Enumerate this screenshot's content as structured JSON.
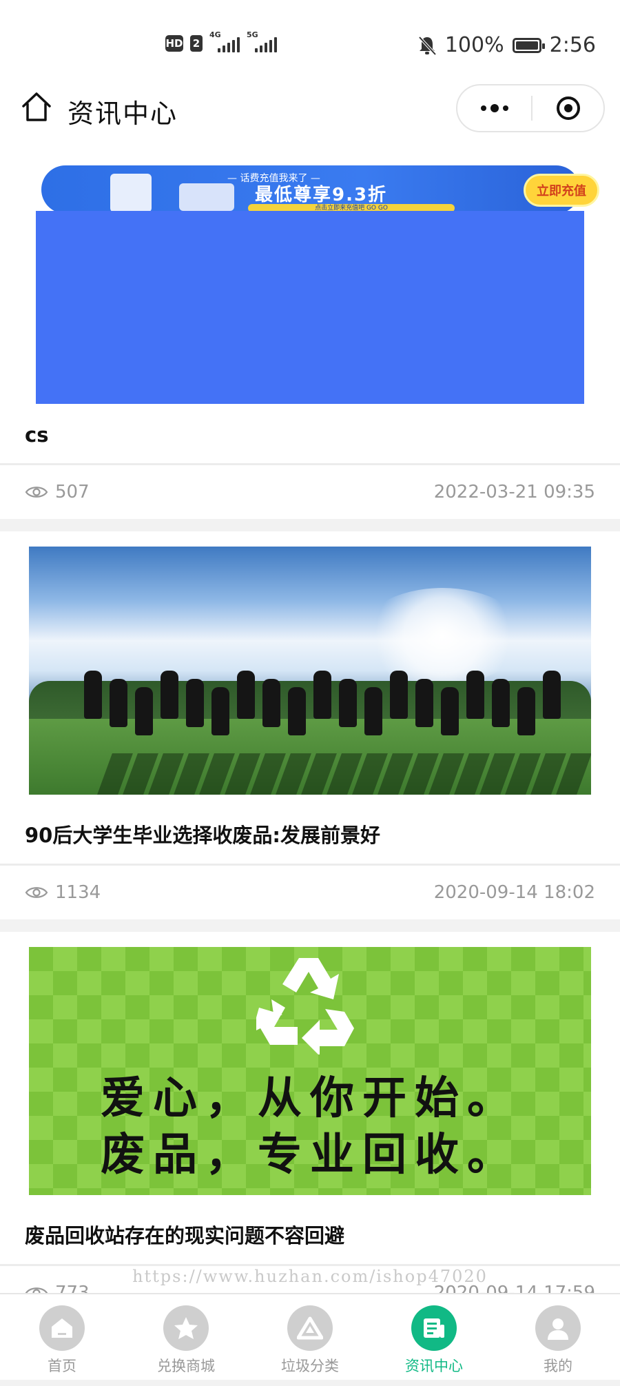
{
  "status_bar": {
    "hd": "HD",
    "sim": "2",
    "network1": "4G",
    "network2": "5G",
    "battery_text": "100%",
    "time": "2:56"
  },
  "nav": {
    "title": "资讯中心"
  },
  "banner": {
    "sub": "— 话费充值我来了 —",
    "main": "最低尊享9.3折",
    "strip": "点击立即来充值吧 GO GO",
    "button": "立即充值"
  },
  "articles": [
    {
      "title": "cs",
      "views": "507",
      "date": "2022-03-21 09:35"
    },
    {
      "title": "90后大学生毕业选择收废品:发展前景好",
      "views": "1134",
      "date": "2020-09-14 18:02"
    },
    {
      "title": "废品回收站存在的现实问题不容回避",
      "views": "773",
      "date": "2020-09-14 17:59",
      "image_text": [
        "爱心，从你开始。",
        "废品，专业回收。"
      ]
    }
  ],
  "watermark": "https://www.huzhan.com/ishop47020",
  "tabs": [
    {
      "label": "首页",
      "icon": "home-icon",
      "active": false
    },
    {
      "label": "兑换商城",
      "icon": "star-icon",
      "active": false
    },
    {
      "label": "垃圾分类",
      "icon": "recycle-icon",
      "active": false
    },
    {
      "label": "资讯中心",
      "icon": "news-icon",
      "active": true
    },
    {
      "label": "我的",
      "icon": "user-icon",
      "active": false
    }
  ],
  "colors": {
    "accent": "#11b985",
    "banner_blue": "#4472f6",
    "meta_gray": "#999999"
  }
}
